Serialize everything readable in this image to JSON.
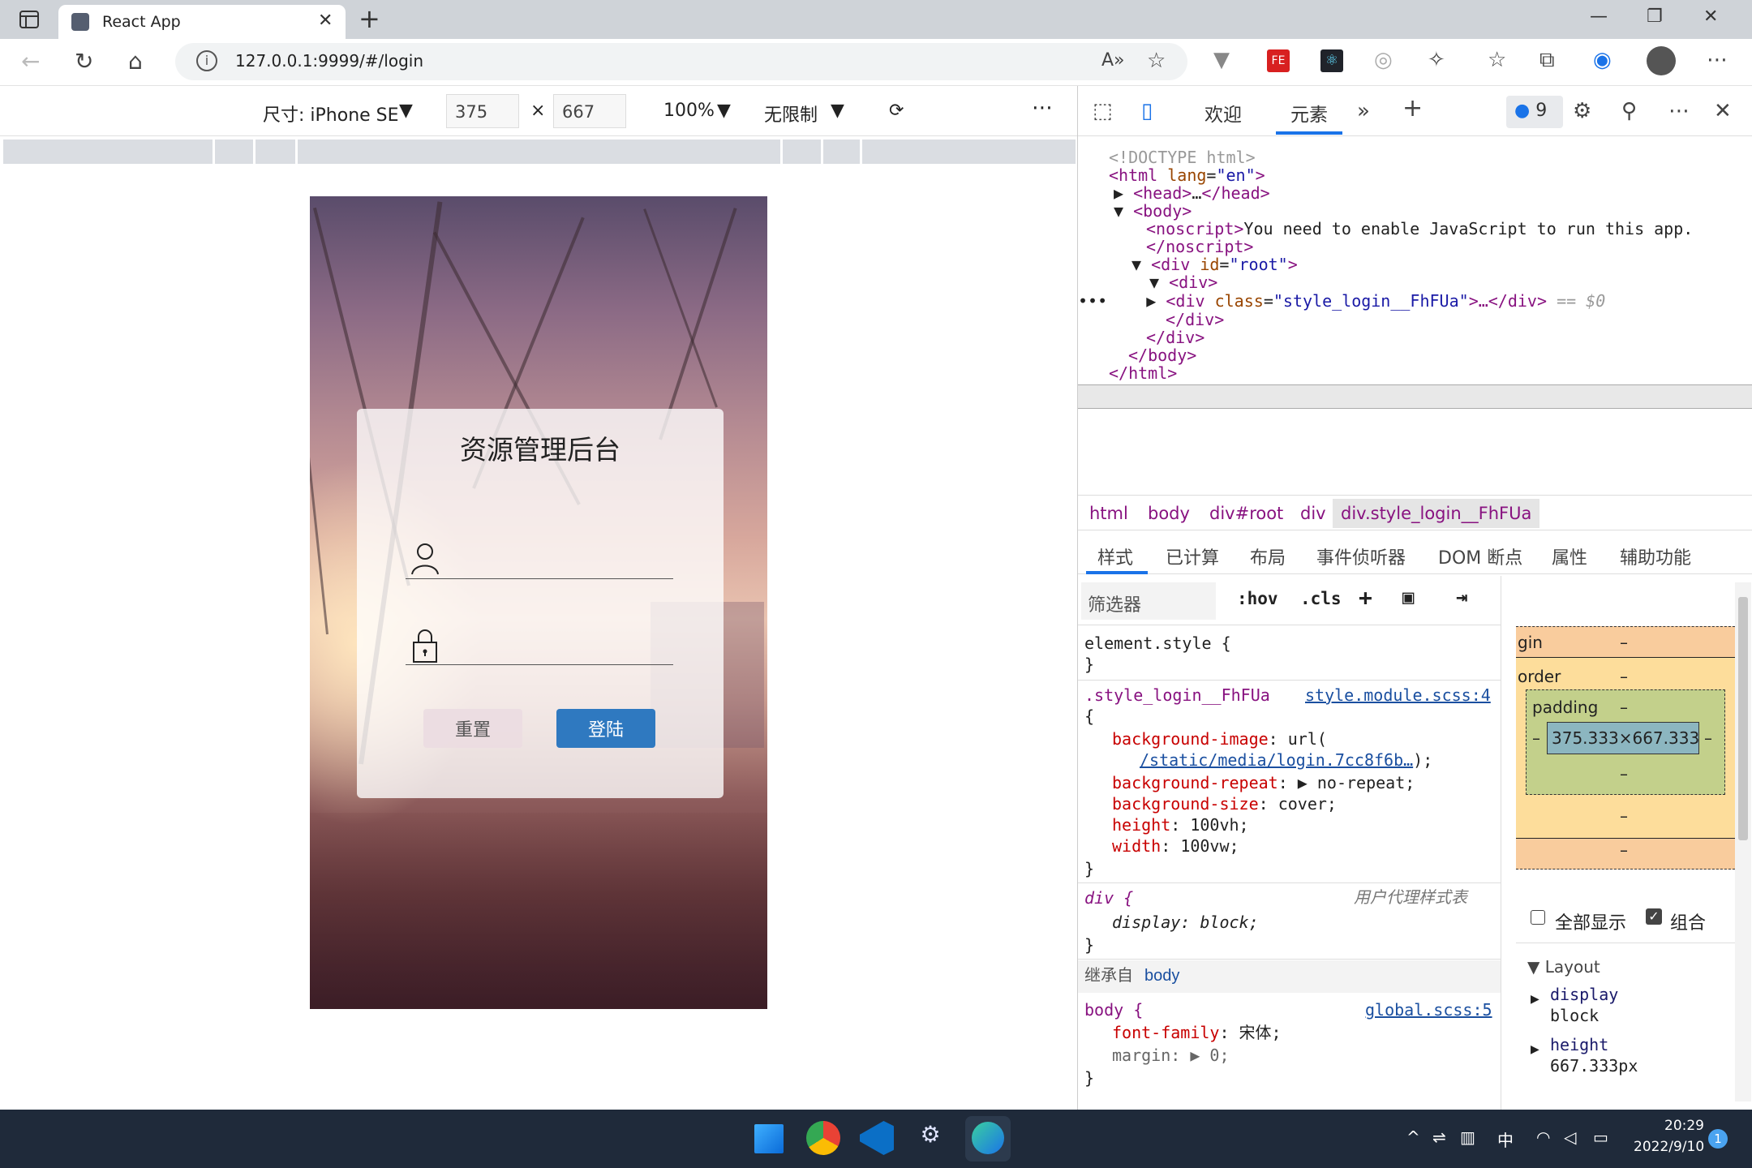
{
  "browser": {
    "tab_title": "React App",
    "url": "127.0.0.1:9999/#/login",
    "newtab_symbol": "+",
    "close_symbol": "✕"
  },
  "device_toolbar": {
    "device_label": "尺寸: iPhone SE",
    "width": "375",
    "times": "×",
    "height": "667",
    "zoom": "100%",
    "throttle": "无限制",
    "more": "⋯"
  },
  "login": {
    "title": "资源管理后台",
    "reset_label": "重置",
    "login_label": "登陆"
  },
  "devtools": {
    "tabs": [
      "欢迎",
      "元素"
    ],
    "issues_count": "9",
    "dom_lines": [
      {
        "open": "<!DOCTYPE html>"
      },
      {
        "tag": "<html ",
        "attr": "lang",
        "val": "\"en\"",
        "close": ">"
      },
      {
        "tag": "<head>",
        "txt": "…",
        "close": "</head>"
      },
      {
        "tag": "<body>"
      },
      {
        "tag": "<noscript>",
        "txt": "You need to enable JavaScript to run this app."
      },
      {
        "tag": "</noscript>"
      },
      {
        "tag": "<div ",
        "attr": "id",
        "val": "\"root\"",
        "close": ">"
      },
      {
        "tag": "<div>"
      },
      {
        "tag": "<div ",
        "attr": "class",
        "val": "\"style_login__FhFUa\"",
        "close": ">…</div>",
        "marker": "== $0"
      },
      {
        "tag": "</div>"
      },
      {
        "tag": "</div>"
      },
      {
        "tag": "</body>"
      },
      {
        "tag": "</html>"
      }
    ],
    "breadcrumbs": [
      "html",
      "body",
      "div#root",
      "div",
      "div.style_login__FhFUa"
    ],
    "subtabs": [
      "样式",
      "已计算",
      "布局",
      "事件侦听器",
      "DOM 断点",
      "属性",
      "辅助功能"
    ],
    "filter_placeholder": "筛选器",
    "hov": ":hov",
    "cls": ".cls",
    "styles": {
      "element_style": "element.style {",
      "brace_close": "}",
      "rule_selector": ".style_login__FhFUa",
      "rule_source": "style.module.scss:4",
      "brace_open": "{",
      "bg_image_prop": "background-image",
      "bg_image_val": "url(",
      "bg_image_url": "/static/media/login.7cc8f6b…",
      "bg_image_end": ");",
      "bg_repeat_prop": "background-repeat",
      "bg_repeat_val": "▶ no-repeat;",
      "bg_size_prop": "background-size",
      "bg_size_val": "cover;",
      "height_prop": "height",
      "height_val": "100vh;",
      "width_prop": "width",
      "width_val": "100vw;",
      "div_selector": "div {",
      "ua_label": "用户代理样式表",
      "display_prop": "display",
      "display_val": "block;",
      "inherited_label": "继承自",
      "inherited_from": "body",
      "body_selector": "body {",
      "body_source": "global.scss:5",
      "font_prop": "font-family",
      "font_val": "宋体;",
      "margin_prop": "margin",
      "margin_val": "▶ 0;"
    },
    "boxmodel": {
      "margin_label": "gin",
      "border_label": "order",
      "padding_label": "padding",
      "dash": "–",
      "content": "375.333×667.333",
      "show_all": "全部显示",
      "group": "组合",
      "layout_title": "Layout",
      "display_name": "display",
      "display_value": "block",
      "height_name": "height",
      "height_value": "667.333px"
    }
  },
  "taskbar": {
    "time": "20:29",
    "date": "2022/9/10",
    "ime": "中",
    "notifications": "1"
  },
  "colors": {
    "login_button": "#2f79c0",
    "accent": "#1a73e8",
    "taskbar": "#1f2a3a"
  }
}
